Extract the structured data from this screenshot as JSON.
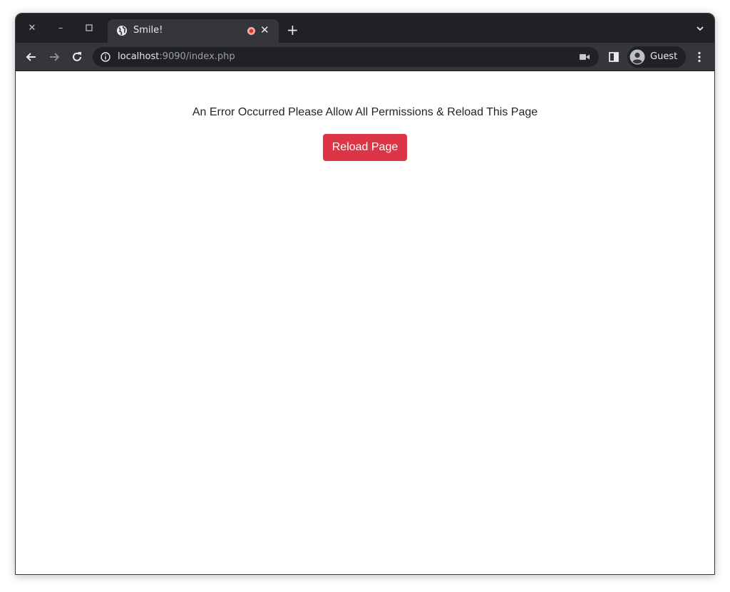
{
  "browser": {
    "tab": {
      "title": "Smile!"
    },
    "window_controls": {
      "close": "✕",
      "minimize": "–",
      "maximize": "▢"
    },
    "address_bar": {
      "host": "localhost",
      "path": ":9090/index.php"
    },
    "profile": {
      "label": "Guest"
    }
  },
  "page": {
    "message": "An Error Occurred Please Allow All Permissions & Reload This Page",
    "reload_button_label": "Reload Page",
    "colors": {
      "button_bg": "#dc3545",
      "button_text": "#ffffff",
      "message_text": "#212529"
    }
  }
}
